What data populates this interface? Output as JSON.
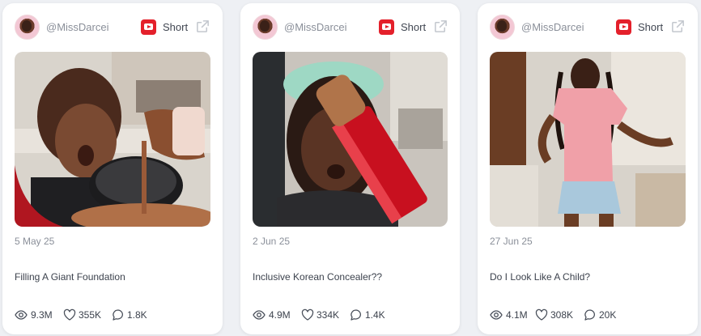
{
  "cards": [
    {
      "handle": "@MissDarcei",
      "platform_icon": "youtube-icon",
      "type": "Short",
      "date": "5 May 25",
      "title": "Filling A Giant Foundation",
      "views": "9.3M",
      "likes": "355K",
      "comments": "1.8K"
    },
    {
      "handle": "@MissDarcei",
      "platform_icon": "youtube-icon",
      "type": "Short",
      "date": "2 Jun 25",
      "title": "Inclusive Korean Concealer??",
      "views": "4.9M",
      "likes": "334K",
      "comments": "1.4K"
    },
    {
      "handle": "@MissDarcei",
      "platform_icon": "youtube-icon",
      "type": "Short",
      "date": "27 Jun 25",
      "title": "Do I Look Like A Child?",
      "views": "4.1M",
      "likes": "308K",
      "comments": "20K"
    }
  ],
  "colors": {
    "youtube_red": "#e4202b",
    "muted_text": "#8a8f99",
    "body_text": "#3c424d"
  }
}
